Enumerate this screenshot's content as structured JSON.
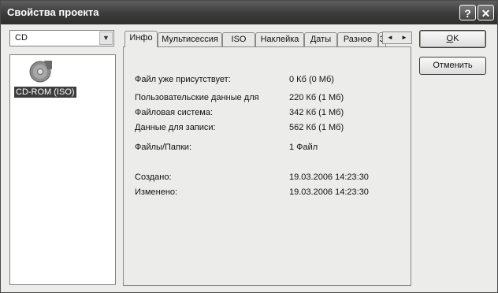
{
  "window": {
    "title": "Свойства проекта",
    "help_glyph": "?",
    "close_glyph": "✕"
  },
  "disc_type": {
    "selected": "CD"
  },
  "project_tree": {
    "items": [
      {
        "label": "CD-ROM (ISO)",
        "icon": "cd-disc-icon",
        "selected": true
      }
    ]
  },
  "tabs": [
    {
      "label": "Инфо",
      "active": true
    },
    {
      "label": "Мультисессия",
      "active": false
    },
    {
      "label": "ISO",
      "active": false
    },
    {
      "label": "Наклейка",
      "active": false
    },
    {
      "label": "Даты",
      "active": false
    },
    {
      "label": "Разное",
      "active": false
    },
    {
      "label": "З",
      "active": false
    }
  ],
  "tab_scroll": {
    "left": "◄",
    "right": "►"
  },
  "info": {
    "already_present": {
      "label": "Файл уже присутствует:",
      "value": "0 Кб (0 Мб)"
    },
    "user_data": {
      "label": "Пользовательские данные для",
      "value": "220 Кб (1 Мб)"
    },
    "file_system": {
      "label": "Файловая система:",
      "value": "342 Кб (1 Мб)"
    },
    "data_to_write": {
      "label": "Данные для записи:",
      "value": "562 Кб (1 Мб)"
    },
    "files_folders": {
      "label": "Файлы/Папки:",
      "value": "1 Файл"
    },
    "created": {
      "label": "Создано:",
      "value": "19.03.2006 14:23:30"
    },
    "modified": {
      "label": "Изменено:",
      "value": "19.03.2006 14:23:30"
    }
  },
  "buttons": {
    "ok_mnemonic": "O",
    "ok_rest": "K",
    "cancel": "Отменить"
  }
}
